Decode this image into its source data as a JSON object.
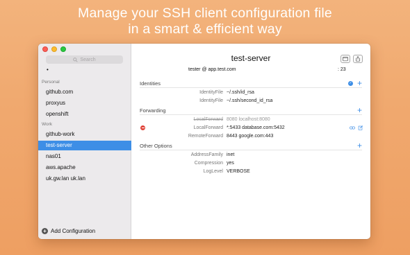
{
  "headline": {
    "line1": "Manage your SSH client configuration file",
    "line2": "in a smart & efficient way"
  },
  "sidebar": {
    "search_placeholder": "Search",
    "default_item": "•",
    "groups": [
      {
        "label": "Personal",
        "items": [
          "github.com",
          "proxyus",
          "openshift"
        ]
      },
      {
        "label": "Work",
        "items": [
          "github-work",
          "test-server",
          "nas01",
          "aws.apache",
          "uk.gw.lan uk.lan"
        ]
      }
    ],
    "selected": "test-server",
    "add_label": "Add Configuration"
  },
  "main": {
    "title": "test-server",
    "connection": "tester @ app.test.com",
    "port": ": 23",
    "sections": {
      "identities": {
        "label": "Identities",
        "rows": [
          {
            "key": "IdentityFile",
            "value": "~/.ssh/id_rsa"
          },
          {
            "key": "IdentityFile",
            "value": "~/.ssh/second_id_rsa"
          }
        ]
      },
      "forwarding": {
        "label": "Forwarding",
        "rows": [
          {
            "key": "LocalForward",
            "value": "8080 localhost:8080"
          },
          {
            "key": "LocalForward",
            "value": "*:5433 database.com:5432"
          },
          {
            "key": "RemoteForward",
            "value": "8443 google.com:443"
          }
        ]
      },
      "other": {
        "label": "Other Options",
        "rows": [
          {
            "key": "AddressFamily",
            "value": "inet"
          },
          {
            "key": "Compression",
            "value": "yes"
          },
          {
            "key": "LogLevel",
            "value": "VERBOSE"
          }
        ]
      }
    }
  },
  "colors": {
    "accent": "#3d8ee6",
    "background": "#f0a96f",
    "danger": "#e0443a"
  },
  "icons": {
    "search": "search-icon",
    "terminal": "terminal-icon",
    "share": "share-icon",
    "add": "plus-icon",
    "check": "check-icon",
    "disable": "minus-circle-icon",
    "link": "link-icon",
    "edit": "edit-icon"
  }
}
